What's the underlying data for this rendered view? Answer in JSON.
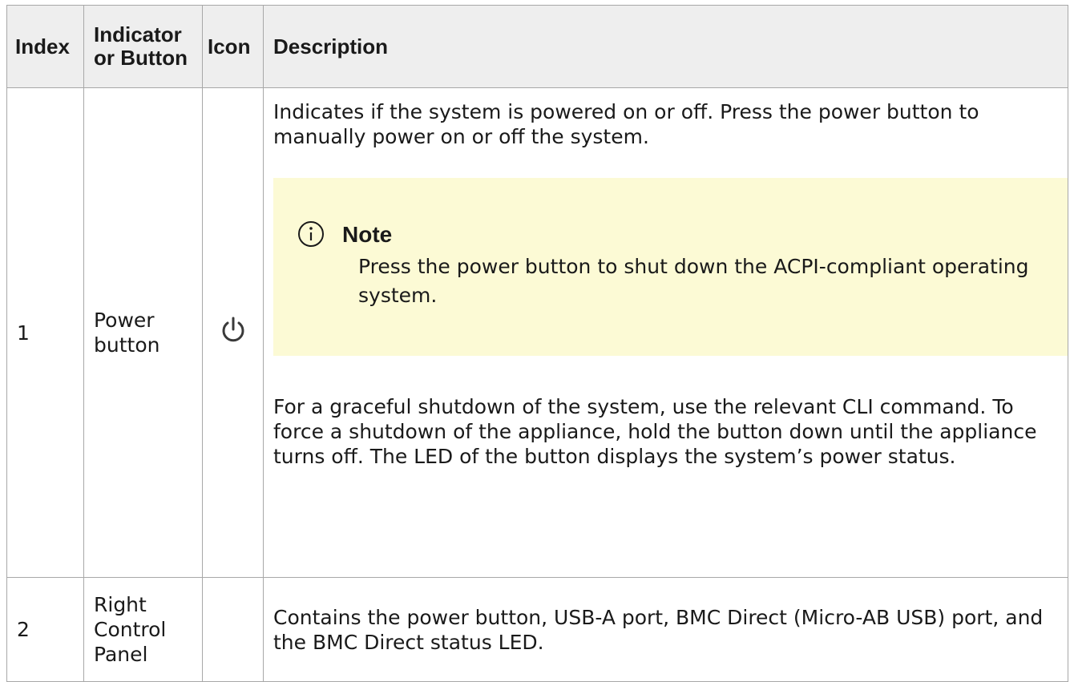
{
  "headers": {
    "index": "Index",
    "indicator": "Indicator or Button",
    "icon": "Icon",
    "description": "Description"
  },
  "rows": [
    {
      "index": "1",
      "name": "Power button",
      "icon": "power-icon",
      "description_intro": "Indicates if the system is powered on or off. Press the power button to manually power on or off the system.",
      "note": {
        "icon": "info-icon",
        "title": "Note",
        "body": "Press the power button to shut down the ACPI-compliant operating system."
      },
      "description_detail": "For a graceful shutdown of the system, use the relevant CLI command. To force a shutdown of the appliance, hold the button down until the appliance turns off. The LED of the button displays the system’s power status."
    },
    {
      "index": "2",
      "name": "Right Control Panel",
      "icon": "",
      "description": "Contains the power button, USB-A port, BMC Direct (Micro-AB USB) port, and the BMC Direct status LED."
    }
  ],
  "colors": {
    "header_bg": "#eeeeee",
    "note_bg": "#fcfad5",
    "border": "#a8a8a8"
  }
}
